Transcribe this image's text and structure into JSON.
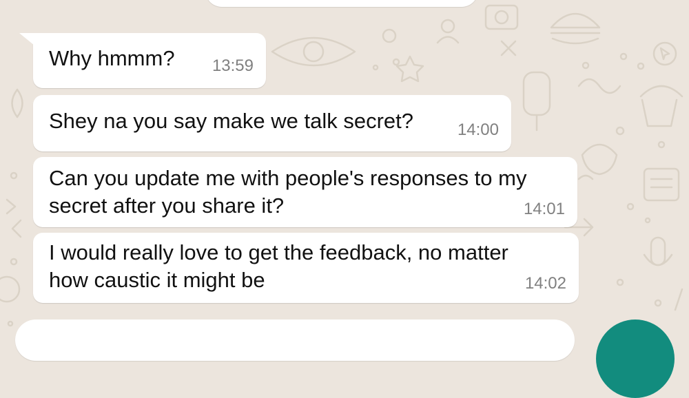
{
  "chat": {
    "messages": [
      {
        "text": "Why hmmm?",
        "time": "13:59"
      },
      {
        "text": "Shey na you say make we talk secret?",
        "time": "14:00"
      },
      {
        "text": "Can you update me with people's responses to my\nsecret after you share it?",
        "time": "14:01"
      },
      {
        "text": "I would really love to get the feedback, no matter\nhow caustic it might be",
        "time": "14:02"
      }
    ]
  },
  "colors": {
    "wallpaper": "#ECE5DD",
    "bubble": "#FFFFFF",
    "timestamp": "#808080",
    "accent": "#128C7E"
  }
}
